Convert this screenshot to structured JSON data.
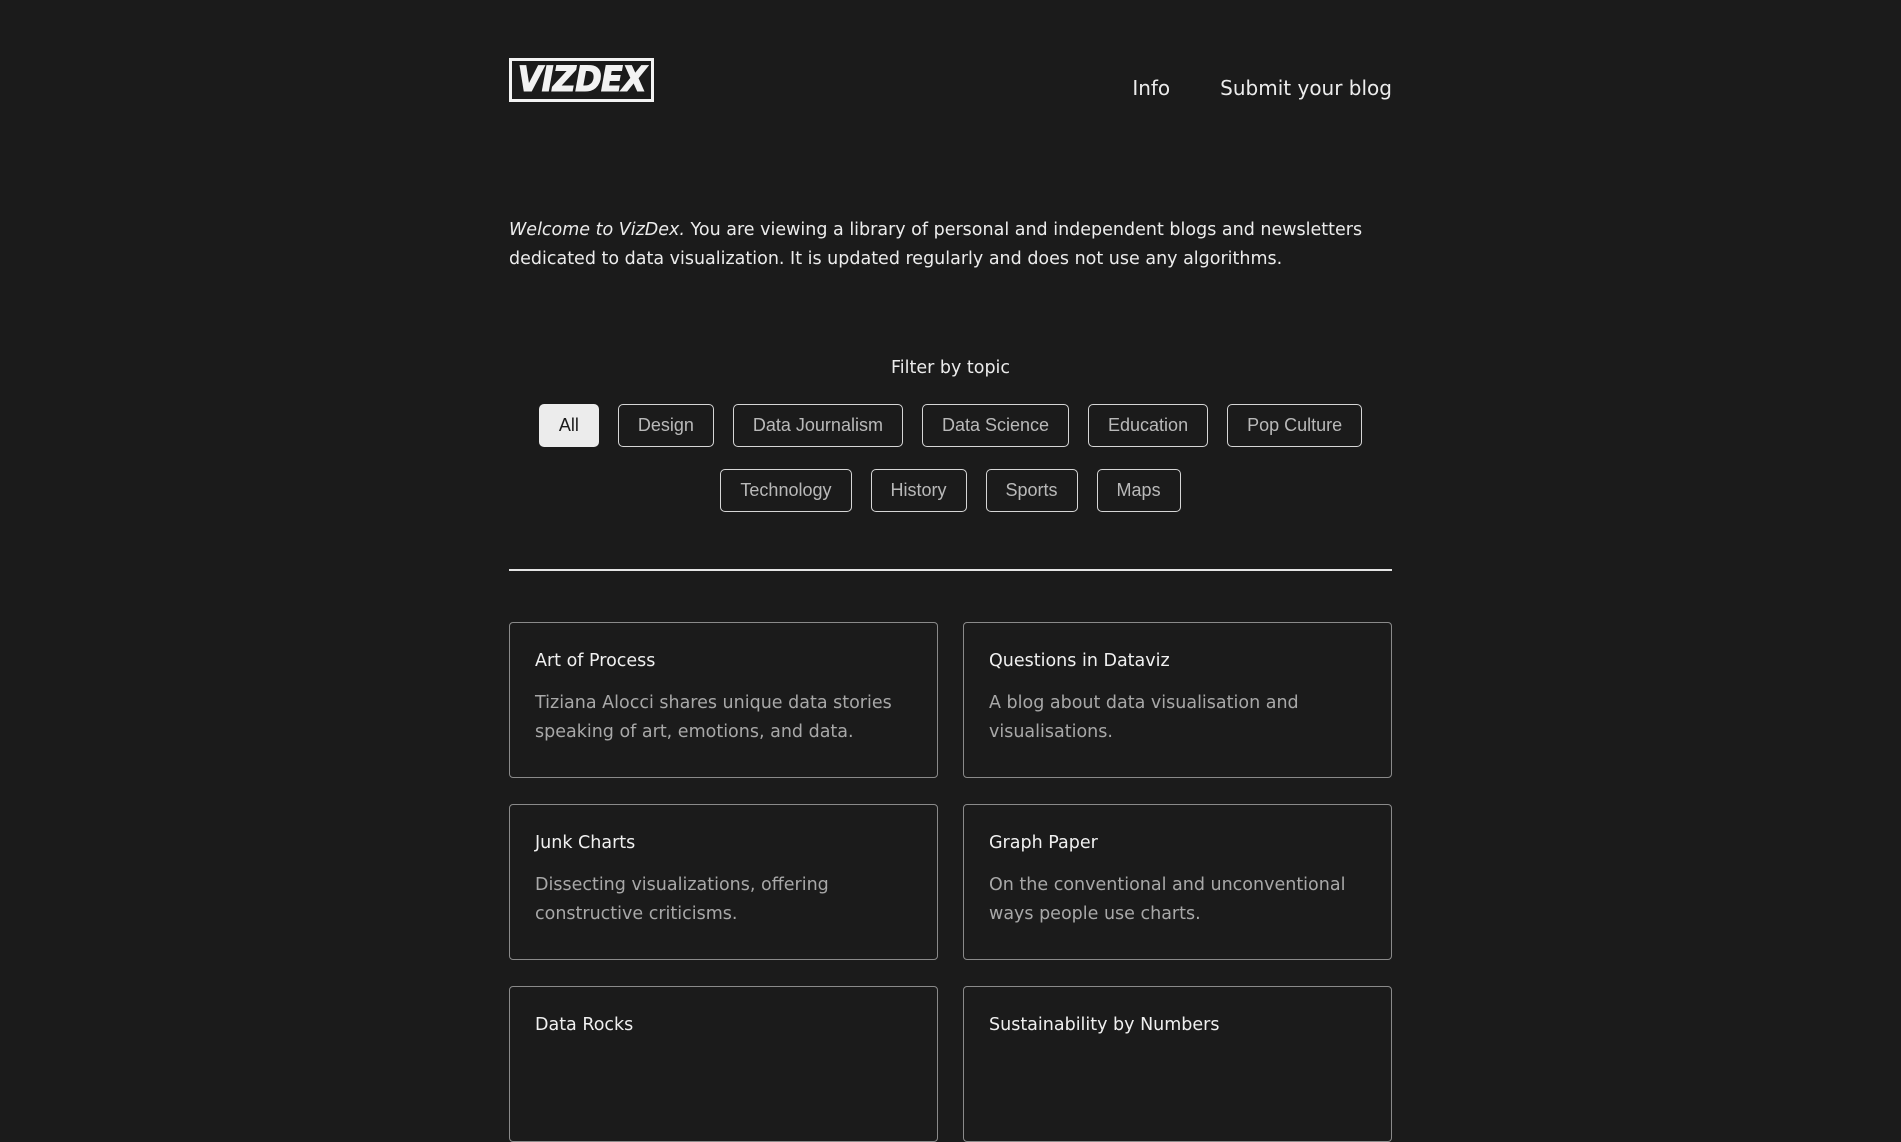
{
  "header": {
    "logo_text": "VIZDEX",
    "nav": [
      {
        "label": "Info"
      },
      {
        "label": "Submit your blog"
      }
    ]
  },
  "intro": {
    "emphasis": "Welcome to VizDex.",
    "text": " You are viewing a library of personal and independent blogs and newsletters dedicated to data visualization. It is updated regularly and does not use any algorithms."
  },
  "filter": {
    "title": "Filter by topic",
    "active": "All",
    "topics_row1": [
      "All",
      "Design",
      "Data Journalism",
      "Data Science",
      "Education",
      "Pop Culture"
    ],
    "topics_row2": [
      "Technology",
      "History",
      "Sports",
      "Maps"
    ]
  },
  "blogs": [
    {
      "title": "Art of Process",
      "description": "Tiziana Alocci shares unique data stories speaking of art, emotions, and data."
    },
    {
      "title": "Questions in Dataviz",
      "description": "A blog about data visualisation and visualisations."
    },
    {
      "title": "Junk Charts",
      "description": "Dissecting visualizations, offering constructive criticisms."
    },
    {
      "title": "Graph Paper",
      "description": "On the conventional and unconventional ways people use charts."
    },
    {
      "title": "Data Rocks",
      "description": ""
    },
    {
      "title": "Sustainability by Numbers",
      "description": ""
    }
  ]
}
